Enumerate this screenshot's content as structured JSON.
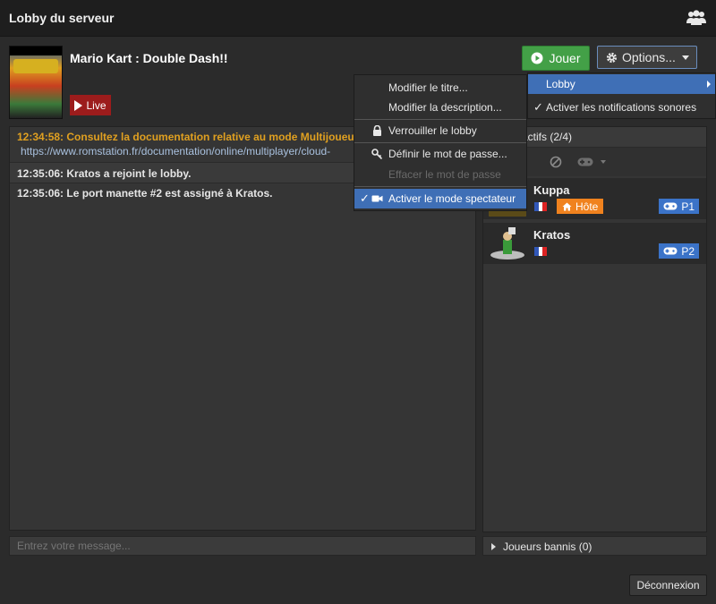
{
  "window": {
    "title": "Lobby du serveur"
  },
  "game": {
    "title": "Mario Kart : Double Dash!!",
    "live_label": "Live"
  },
  "toolbar": {
    "play_label": "Jouer",
    "options_label": "Options..."
  },
  "options_menu": {
    "lobby_label": "Lobby",
    "notifications_label": "Activer les notifications sonores",
    "notifications_checked": true
  },
  "lobby_menu": {
    "items": [
      {
        "label": "Modifier le titre...",
        "enabled": true
      },
      {
        "label": "Modifier la description...",
        "enabled": true
      },
      {
        "label": "Verrouiller le lobby",
        "enabled": true,
        "icon": "lock-icon"
      },
      {
        "label": "Définir le mot de passe...",
        "enabled": true,
        "icon": "key-icon"
      },
      {
        "label": "Effacer le mot de passe",
        "enabled": false
      },
      {
        "label": "Activer le mode spectateur",
        "enabled": true,
        "icon": "camera-icon",
        "checked": true
      }
    ]
  },
  "chat": {
    "messages": [
      {
        "time": "12:34:58",
        "text": "12:34:58: Consultez la documentation relative au mode Multijoueur à c",
        "link": "https://www.romstation.fr/documentation/online/multiplayer/cloud-"
      },
      {
        "time": "12:35:06",
        "text": "12:35:06: Kratos a rejoint le lobby."
      },
      {
        "time": "12:35:06",
        "text": "12:35:06: Le port manette #2 est assigné à Kratos."
      }
    ],
    "input_placeholder": "Entrez votre message..."
  },
  "players": {
    "header_label": "urs actifs (2/4)",
    "list": [
      {
        "name": "Kuppa",
        "host_label": "Hôte",
        "port_label": "P1"
      },
      {
        "name": "Kratos",
        "port_label": "P2"
      }
    ],
    "banned_label": "Joueurs bannis (0)"
  },
  "footer": {
    "disconnect_label": "Déconnexion"
  },
  "colors": {
    "accent": "#3f6fb6",
    "play_green": "#43a047",
    "live_red": "#9c1c1c",
    "host_orange": "#f0821e",
    "system_message": "#e0a020"
  }
}
